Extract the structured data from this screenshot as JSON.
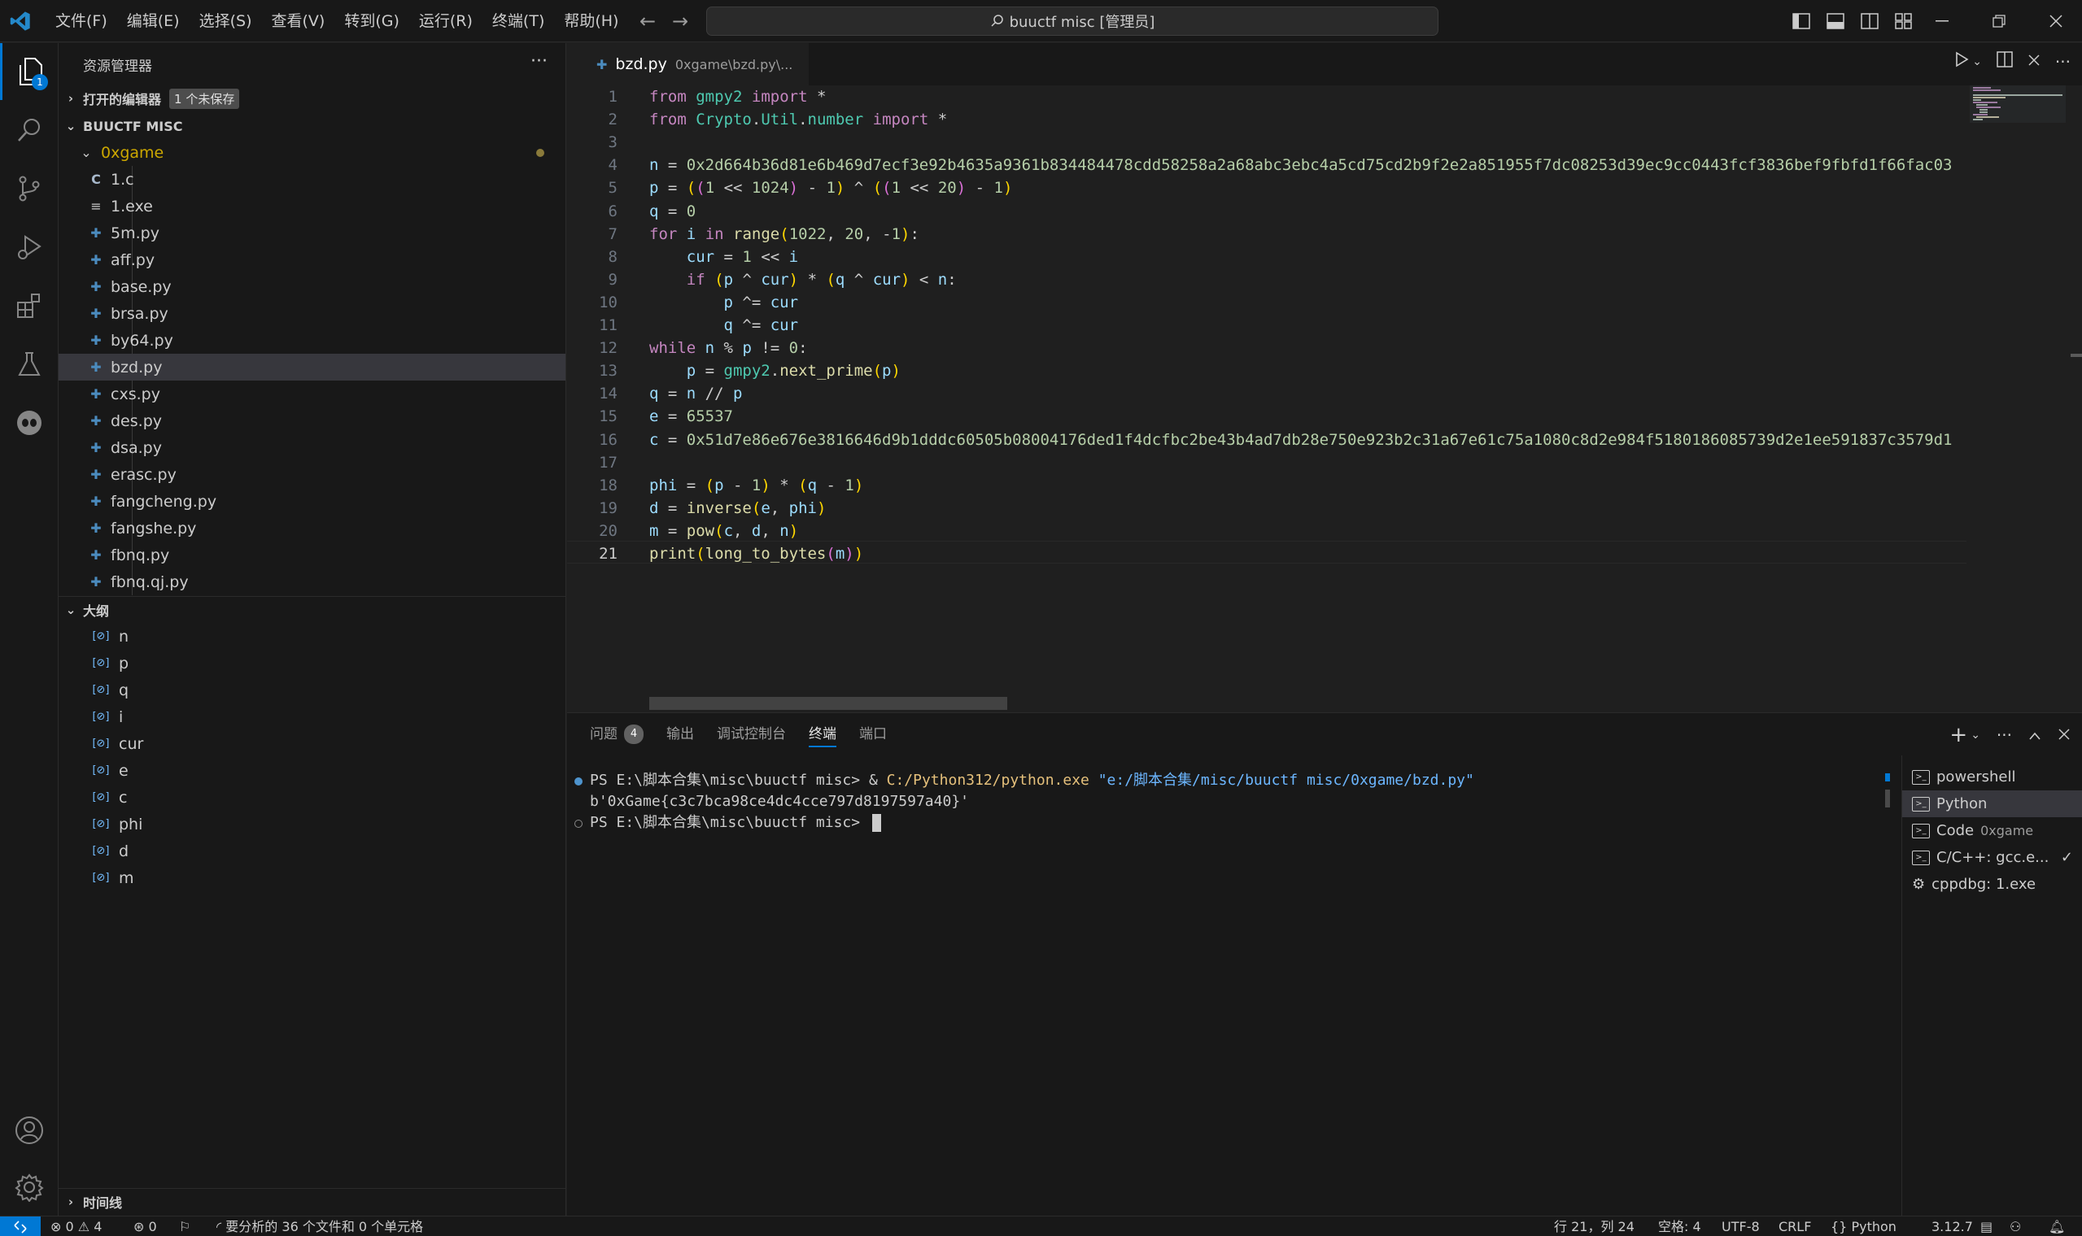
{
  "menubar": [
    "文件(F)",
    "编辑(E)",
    "选择(S)",
    "查看(V)",
    "转到(G)",
    "运行(R)",
    "终端(T)",
    "帮助(H)"
  ],
  "command_center": "buuctf misc [管理员]",
  "activity": {
    "explorer_badge": "1"
  },
  "sidebar": {
    "title": "资源管理器",
    "open_editors": {
      "label": "打开的编辑器",
      "badge": "1 个未保存"
    },
    "workspace": "BUUCTF MISC",
    "folder": "0xgame",
    "files": [
      "1.c",
      "1.exe",
      "5m.py",
      "aff.py",
      "base.py",
      "brsa.py",
      "by64.py",
      "bzd.py",
      "cxs.py",
      "des.py",
      "dsa.py",
      "erasc.py",
      "fangcheng.py",
      "fangshe.py",
      "fbnq.py",
      "fbnq.qj.py"
    ],
    "selected_file": "bzd.py",
    "outline_label": "大纲",
    "outline": [
      "n",
      "p",
      "q",
      "i",
      "cur",
      "e",
      "c",
      "phi",
      "d",
      "m"
    ],
    "timeline_label": "时间线"
  },
  "editor": {
    "tab_name": "bzd.py",
    "tab_path": "0xgame\\bzd.py\\...",
    "current_line": 21,
    "lines": [
      "from gmpy2 import *",
      "from Crypto.Util.number import *",
      "",
      "n = 0x2d664b36d81e6b469d7ecf3e92b4635a9361b834484478cdd58258a2a68abc3ebc4a5cd75cd2b9f2e2a851955f7dc08253d39ec9cc0443fcf3836bef9fbfd1f66fac03",
      "p = ((1 << 1024) - 1) ^ ((1 << 20) - 1)",
      "q = 0",
      "for i in range(1022, 20, -1):",
      "    cur = 1 << i",
      "    if (p ^ cur) * (q ^ cur) < n:",
      "        p ^= cur",
      "        q ^= cur",
      "while n % p != 0:",
      "    p = gmpy2.next_prime(p)",
      "q = n // p",
      "e = 65537",
      "c = 0x51d7e86e676e3816646d9b1dddc60505b08004176ded1f4dcfbc2be43b4ad7db28e750e923b2c31a67e61c75a1080c8d2e984f5180186085739d2e1ee591837c3579d1",
      "",
      "phi = (p - 1) * (q - 1)",
      "d = inverse(e, phi)",
      "m = pow(c, d, n)",
      "print(long_to_bytes(m))"
    ]
  },
  "panel": {
    "tabs": [
      {
        "label": "问题",
        "badge": "4"
      },
      {
        "label": "输出"
      },
      {
        "label": "调试控制台"
      },
      {
        "label": "终端",
        "active": true
      },
      {
        "label": "端口"
      }
    ],
    "terminal": {
      "line1_prompt": "PS E:\\脚本合集\\misc\\buuctf misc> ",
      "line1_amp": "& ",
      "line1_exe": "C:/Python312/python.exe",
      "line1_arg": " \"e:/脚本合集/misc/buuctf misc/0xgame/bzd.py\"",
      "line2": "b'0xGame{c3c7bca98ce4dc4cce797d8197597a40}'",
      "line3_prompt": "PS E:\\脚本合集\\misc\\buuctf misc> "
    },
    "terminal_list": [
      {
        "name": "powershell",
        "desc": ""
      },
      {
        "name": "Python",
        "desc": ""
      },
      {
        "name": "Code",
        "desc": "0xgame"
      },
      {
        "name": "C/C++: gcc.e...",
        "desc": ""
      },
      {
        "name": "cppdbg: 1.exe",
        "desc": ""
      }
    ]
  },
  "statusbar": {
    "errors": "0",
    "warnings": "4",
    "ports": "0",
    "analysis": "要分析的 36 个文件和 0 个单元格",
    "position": "行 21，列 24",
    "spaces": "空格: 4",
    "encoding": "UTF-8",
    "eol": "CRLF",
    "language": "Python",
    "version": "3.12.7"
  },
  "colors": {
    "accent": "#0078d4",
    "background": "#1f1f1f",
    "sidebar": "#181818"
  }
}
